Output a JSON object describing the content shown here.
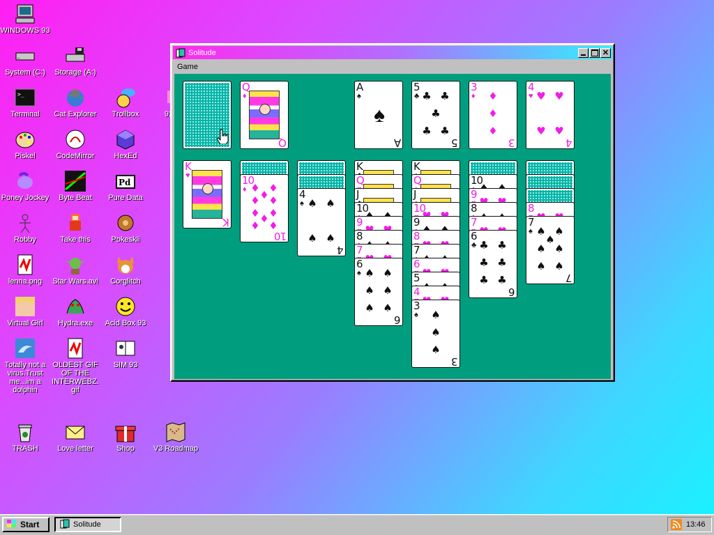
{
  "desktop": {
    "icons": [
      {
        "label": "WINDOWS 93",
        "icon": "computer-icon"
      },
      {
        "label": "System (C:)",
        "icon": "drive-icon"
      },
      {
        "label": "Storage (A:)",
        "icon": "floppy-drive-icon"
      },
      {
        "label": "Terminal",
        "icon": "terminal-icon"
      },
      {
        "label": "Cat Explorer",
        "icon": "cat-globe-icon"
      },
      {
        "label": "Trollbox",
        "icon": "troll-chat-icon"
      },
      {
        "label": "93",
        "icon": "partial-icon"
      },
      {
        "label": "Piskel",
        "icon": "palette-icon"
      },
      {
        "label": "CodeMirror",
        "icon": "codemirror-icon"
      },
      {
        "label": "HexEd",
        "icon": "hex-cube-icon"
      },
      {
        "label": "Poney Jockey",
        "icon": "pony-icon"
      },
      {
        "label": "Byte Beat",
        "icon": "bytebeat-icon"
      },
      {
        "label": "Pure Data",
        "icon": "puredata-icon"
      },
      {
        "label": "Robby",
        "icon": "robot-icon"
      },
      {
        "label": "Take this",
        "icon": "pixel-character-icon"
      },
      {
        "label": "Pokeskii",
        "icon": "pokemon-icon"
      },
      {
        "label": "lenna.png",
        "icon": "image-file-icon"
      },
      {
        "label": "Star Wars.avi",
        "icon": "yoda-icon"
      },
      {
        "label": "Corglitch",
        "icon": "corgi-icon"
      },
      {
        "label": "Virtual Girl",
        "icon": "virtual-girl-icon"
      },
      {
        "label": "Hydra.exe",
        "icon": "hydra-icon"
      },
      {
        "label": "Acid Box 93",
        "icon": "smiley-icon"
      },
      {
        "label": "Totally not a virus.Trust me...im a dolphin",
        "icon": "dolphin-icon"
      },
      {
        "label": "OLDEST GIF OF THE INTERWEBZ.gif",
        "icon": "gif-file-icon"
      },
      {
        "label": "SIM 93",
        "icon": "sim-book-icon"
      },
      {
        "label": "TRASH",
        "icon": "trash-icon"
      },
      {
        "label": "Love letter",
        "icon": "envelope-icon"
      },
      {
        "label": "Shop",
        "icon": "gift-icon"
      },
      {
        "label": "V3 Roadmap",
        "icon": "map-icon"
      }
    ]
  },
  "window": {
    "title": "Solitude",
    "menu": [
      "Game"
    ],
    "buttons": {
      "minimize": "_",
      "maximize": "□",
      "close": "×"
    }
  },
  "game": {
    "stock": "face-down",
    "waste": [
      {
        "rank": "Q",
        "suit": "♦"
      }
    ],
    "foundations": [
      {
        "rank": "A",
        "suit": "♠"
      },
      {
        "rank": "5",
        "suit": "♣"
      },
      {
        "rank": "3",
        "suit": "♦"
      },
      {
        "rank": "4",
        "suit": "♥"
      }
    ],
    "tableau": [
      {
        "hidden": 0,
        "cards": [
          {
            "rank": "K",
            "suit": "♥"
          }
        ]
      },
      {
        "hidden": 1,
        "cards": [
          {
            "rank": "10",
            "suit": "♦"
          }
        ]
      },
      {
        "hidden": 2,
        "cards": [
          {
            "rank": "4",
            "suit": "♠"
          }
        ]
      },
      {
        "hidden": 0,
        "cards": [
          {
            "rank": "K",
            "suit": "♣"
          },
          {
            "rank": "Q",
            "suit": "♥"
          },
          {
            "rank": "J",
            "suit": "♣"
          },
          {
            "rank": "10",
            "suit": "♠"
          },
          {
            "rank": "9",
            "suit": "♥"
          },
          {
            "rank": "8",
            "suit": "♠"
          },
          {
            "rank": "7",
            "suit": "♥"
          },
          {
            "rank": "6",
            "suit": "♠"
          }
        ]
      },
      {
        "hidden": 0,
        "cards": [
          {
            "rank": "K",
            "suit": "♠"
          },
          {
            "rank": "Q",
            "suit": "♦"
          },
          {
            "rank": "J",
            "suit": "♠"
          },
          {
            "rank": "10",
            "suit": "♥"
          },
          {
            "rank": "9",
            "suit": "♠"
          },
          {
            "rank": "8",
            "suit": "♥"
          },
          {
            "rank": "7",
            "suit": "♠"
          },
          {
            "rank": "6",
            "suit": "♥"
          },
          {
            "rank": "5",
            "suit": "♠"
          },
          {
            "rank": "4",
            "suit": "♥"
          },
          {
            "rank": "3",
            "suit": "♠"
          }
        ]
      },
      {
        "hidden": 1,
        "cards": [
          {
            "rank": "10",
            "suit": "♠"
          },
          {
            "rank": "9",
            "suit": "♥"
          },
          {
            "rank": "8",
            "suit": "♠"
          },
          {
            "rank": "7",
            "suit": "♥"
          },
          {
            "rank": "6",
            "suit": "♣"
          }
        ]
      },
      {
        "hidden": 3,
        "cards": [
          {
            "rank": "8",
            "suit": "♥"
          },
          {
            "rank": "7",
            "suit": "♠"
          }
        ]
      }
    ]
  },
  "taskbar": {
    "start_label": "Start",
    "tasks": [
      {
        "label": "Solitude"
      }
    ],
    "clock": "13:46"
  },
  "colors": {
    "felt": "#009e7e",
    "red_suit": "#f01ee6",
    "black_suit": "#111111"
  }
}
